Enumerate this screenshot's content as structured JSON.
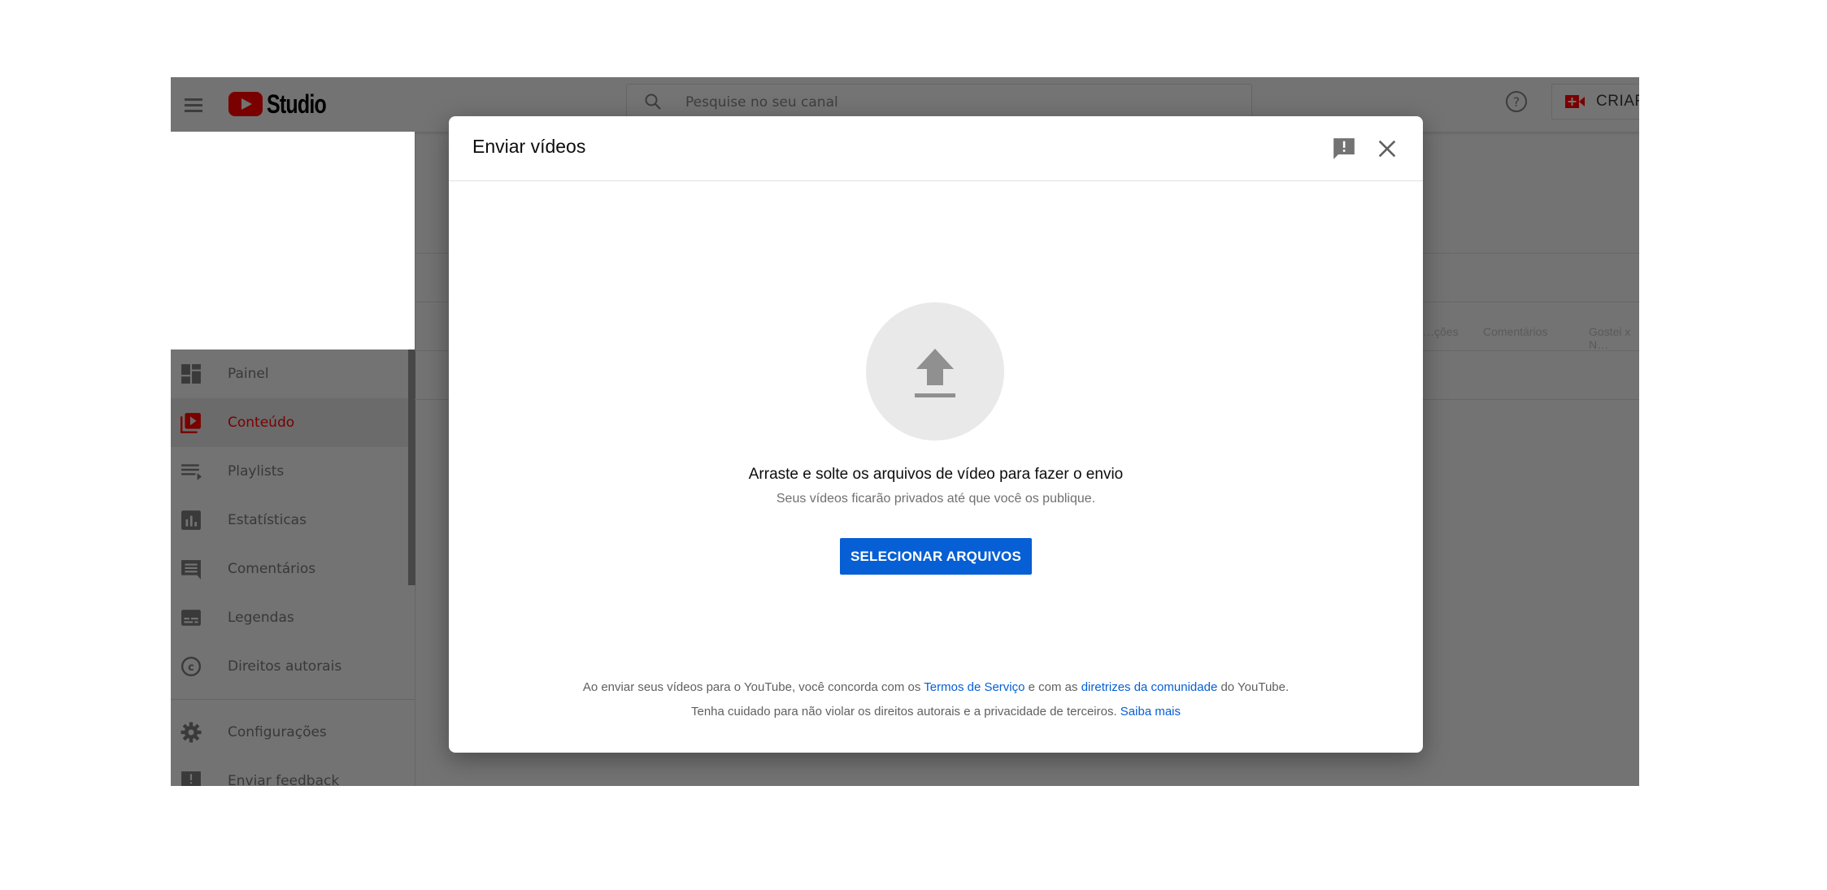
{
  "header": {
    "logo_text": "Studio",
    "search_placeholder": "Pesquise no seu canal",
    "create_label": "CRIAR"
  },
  "sidebar": {
    "items": [
      {
        "label": "Painel",
        "icon": "dashboard-icon",
        "active": false
      },
      {
        "label": "Conteúdo",
        "icon": "content-icon",
        "active": true
      },
      {
        "label": "Playlists",
        "icon": "playlist-icon",
        "active": false
      },
      {
        "label": "Estatísticas",
        "icon": "analytics-icon",
        "active": false
      },
      {
        "label": "Comentários",
        "icon": "comments-icon",
        "active": false
      },
      {
        "label": "Legendas",
        "icon": "subtitles-icon",
        "active": false
      },
      {
        "label": "Direitos autorais",
        "icon": "copyright-icon",
        "active": false
      }
    ],
    "bottom_items": [
      {
        "label": "Configurações",
        "icon": "gear-icon"
      },
      {
        "label": "Enviar feedback",
        "icon": "feedback-icon"
      }
    ]
  },
  "background_table": {
    "visible_column_headers": [
      "…ções",
      "Comentários",
      "Gostei x N…"
    ]
  },
  "colors": {
    "accent_blue": "#065fd4",
    "brand_red_dimmed": "#7a0000",
    "overlay_gray": "#737373"
  },
  "dialog": {
    "title": "Enviar vídeos",
    "drop_text": "Arraste e solte os arquivos de vídeo para fazer o envio",
    "private_text": "Seus vídeos ficarão privados até que você os publique.",
    "select_button": "SELECIONAR ARQUIVOS",
    "terms": {
      "part1": "Ao enviar seus vídeos para o YouTube, você concorda com os ",
      "tos_link": "Termos de Serviço",
      "part2": " e com as ",
      "guidelines_link": "diretrizes da comunidade",
      "part3": " do YouTube."
    },
    "notice": {
      "text": "Tenha cuidado para não violar os direitos autorais e a privacidade de terceiros. ",
      "learn_more_link": "Saiba mais"
    }
  }
}
